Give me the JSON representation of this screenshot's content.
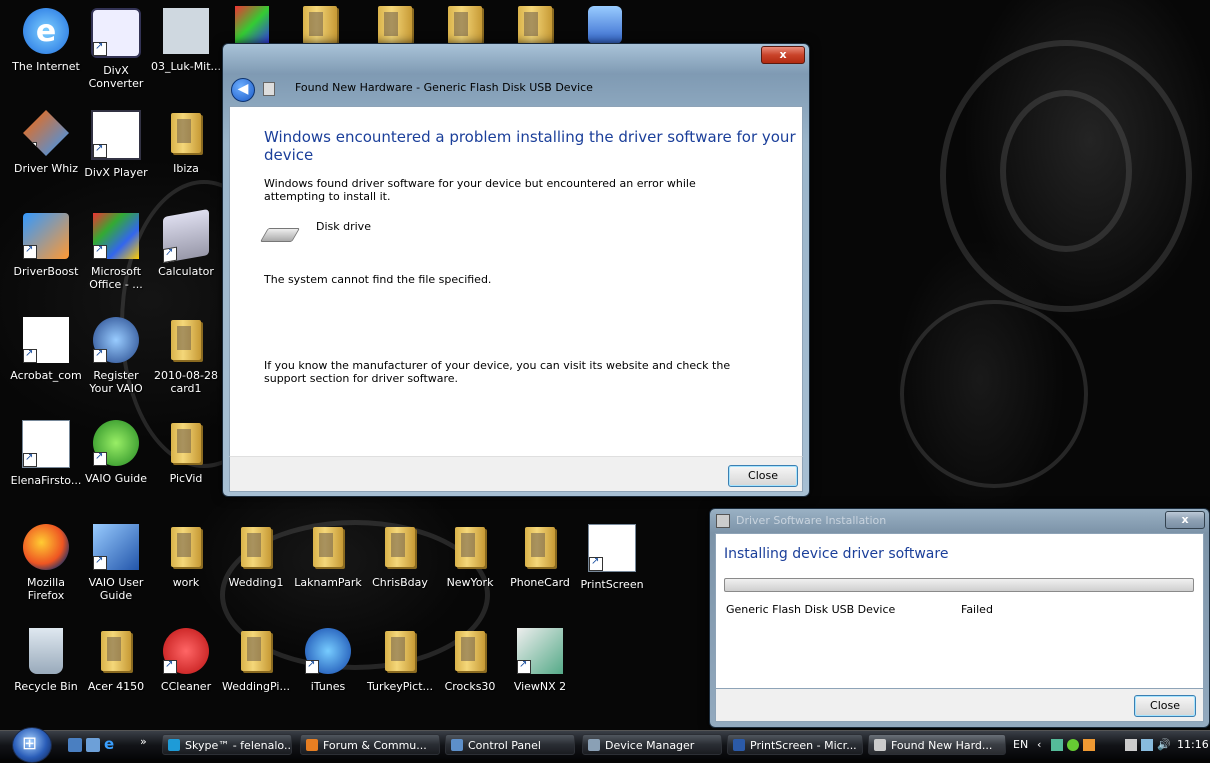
{
  "desktop": {
    "icons": [
      {
        "label": "The Internet",
        "glyph": "ie-icon"
      },
      {
        "label": "DivX Converter",
        "glyph": "divx-converter-icon"
      },
      {
        "label": "03_Luk-Mit...",
        "glyph": "music-file-icon"
      },
      {
        "label": "Driver Whiz",
        "glyph": "driver-whiz-icon"
      },
      {
        "label": "DivX Player",
        "glyph": "divx-player-icon"
      },
      {
        "label": "Ibiza",
        "glyph": "folder-icon"
      },
      {
        "label": "DriverBoost",
        "glyph": "driverboost-icon"
      },
      {
        "label": "Microsoft Office - ...",
        "glyph": "office-icon"
      },
      {
        "label": "Calculator",
        "glyph": "calculator-icon"
      },
      {
        "label": "Acrobat_com",
        "glyph": "acrobat-icon"
      },
      {
        "label": "Register Your VAIO",
        "glyph": "vaio-icon"
      },
      {
        "label": "2010-08-28 card1",
        "glyph": "folder-icon"
      },
      {
        "label": "ElenaFirsto...",
        "glyph": "word-doc-icon"
      },
      {
        "label": "VAIO Guide",
        "glyph": "vaio-guide-icon"
      },
      {
        "label": "PicVid",
        "glyph": "folder-icon"
      },
      {
        "label": "Mozilla Firefox",
        "glyph": "firefox-icon"
      },
      {
        "label": "VAIO User Guide",
        "glyph": "vaio-user-guide-icon"
      },
      {
        "label": "work",
        "glyph": "folder-icon"
      },
      {
        "label": "Wedding1",
        "glyph": "folder-icon"
      },
      {
        "label": "LaknamPark",
        "glyph": "folder-icon"
      },
      {
        "label": "ChrisBday",
        "glyph": "folder-icon"
      },
      {
        "label": "NewYork",
        "glyph": "folder-icon"
      },
      {
        "label": "PhoneCard",
        "glyph": "folder-icon"
      },
      {
        "label": "PrintScreen",
        "glyph": "word-doc-icon"
      },
      {
        "label": "Recycle Bin",
        "glyph": "recycle-bin-icon"
      },
      {
        "label": "Acer 4150",
        "glyph": "folder-icon"
      },
      {
        "label": "CCleaner",
        "glyph": "ccleaner-icon"
      },
      {
        "label": "WeddingPi...",
        "glyph": "folder-icon"
      },
      {
        "label": "iTunes",
        "glyph": "itunes-icon"
      },
      {
        "label": "TurkeyPict...",
        "glyph": "folder-icon"
      },
      {
        "label": "Crocks30",
        "glyph": "folder-icon"
      },
      {
        "label": "ViewNX 2",
        "glyph": "viewnx-icon"
      }
    ]
  },
  "main_dialog": {
    "title": "Found New Hardware - Generic Flash Disk USB Device",
    "close_glyph": "x",
    "heading": "Windows encountered a problem installing the driver software for your device",
    "line1": "Windows found driver software for your device but encountered an error while attempting to install it.",
    "device_name": "Disk drive",
    "error": "The system cannot find the file specified.",
    "help": "If you know the manufacturer of your device, you can visit its website and check the support section for driver software.",
    "close_label": "Close"
  },
  "install_dialog": {
    "title": "Driver Software Installation",
    "close_glyph": "x",
    "heading": "Installing device driver software",
    "progress_fraction": 0.0,
    "device": "Generic Flash Disk USB Device",
    "status": "Failed",
    "close_label": "Close"
  },
  "taskbar": {
    "overflow_glyph": "»",
    "buttons": [
      {
        "label": "Skype™ - felenalo...",
        "color": "#1e9bd7"
      },
      {
        "label": "Forum & Commu...",
        "color": "#e67e22"
      },
      {
        "label": "Control Panel",
        "color": "#5d8fc9"
      },
      {
        "label": "Device Manager",
        "color": "#8aa0b5"
      },
      {
        "label": "PrintScreen - Micr...",
        "color": "#2b5aa8"
      },
      {
        "label": "Found New Hard...",
        "color": "#cccccc"
      }
    ],
    "lang": "EN",
    "time": "11:16"
  }
}
